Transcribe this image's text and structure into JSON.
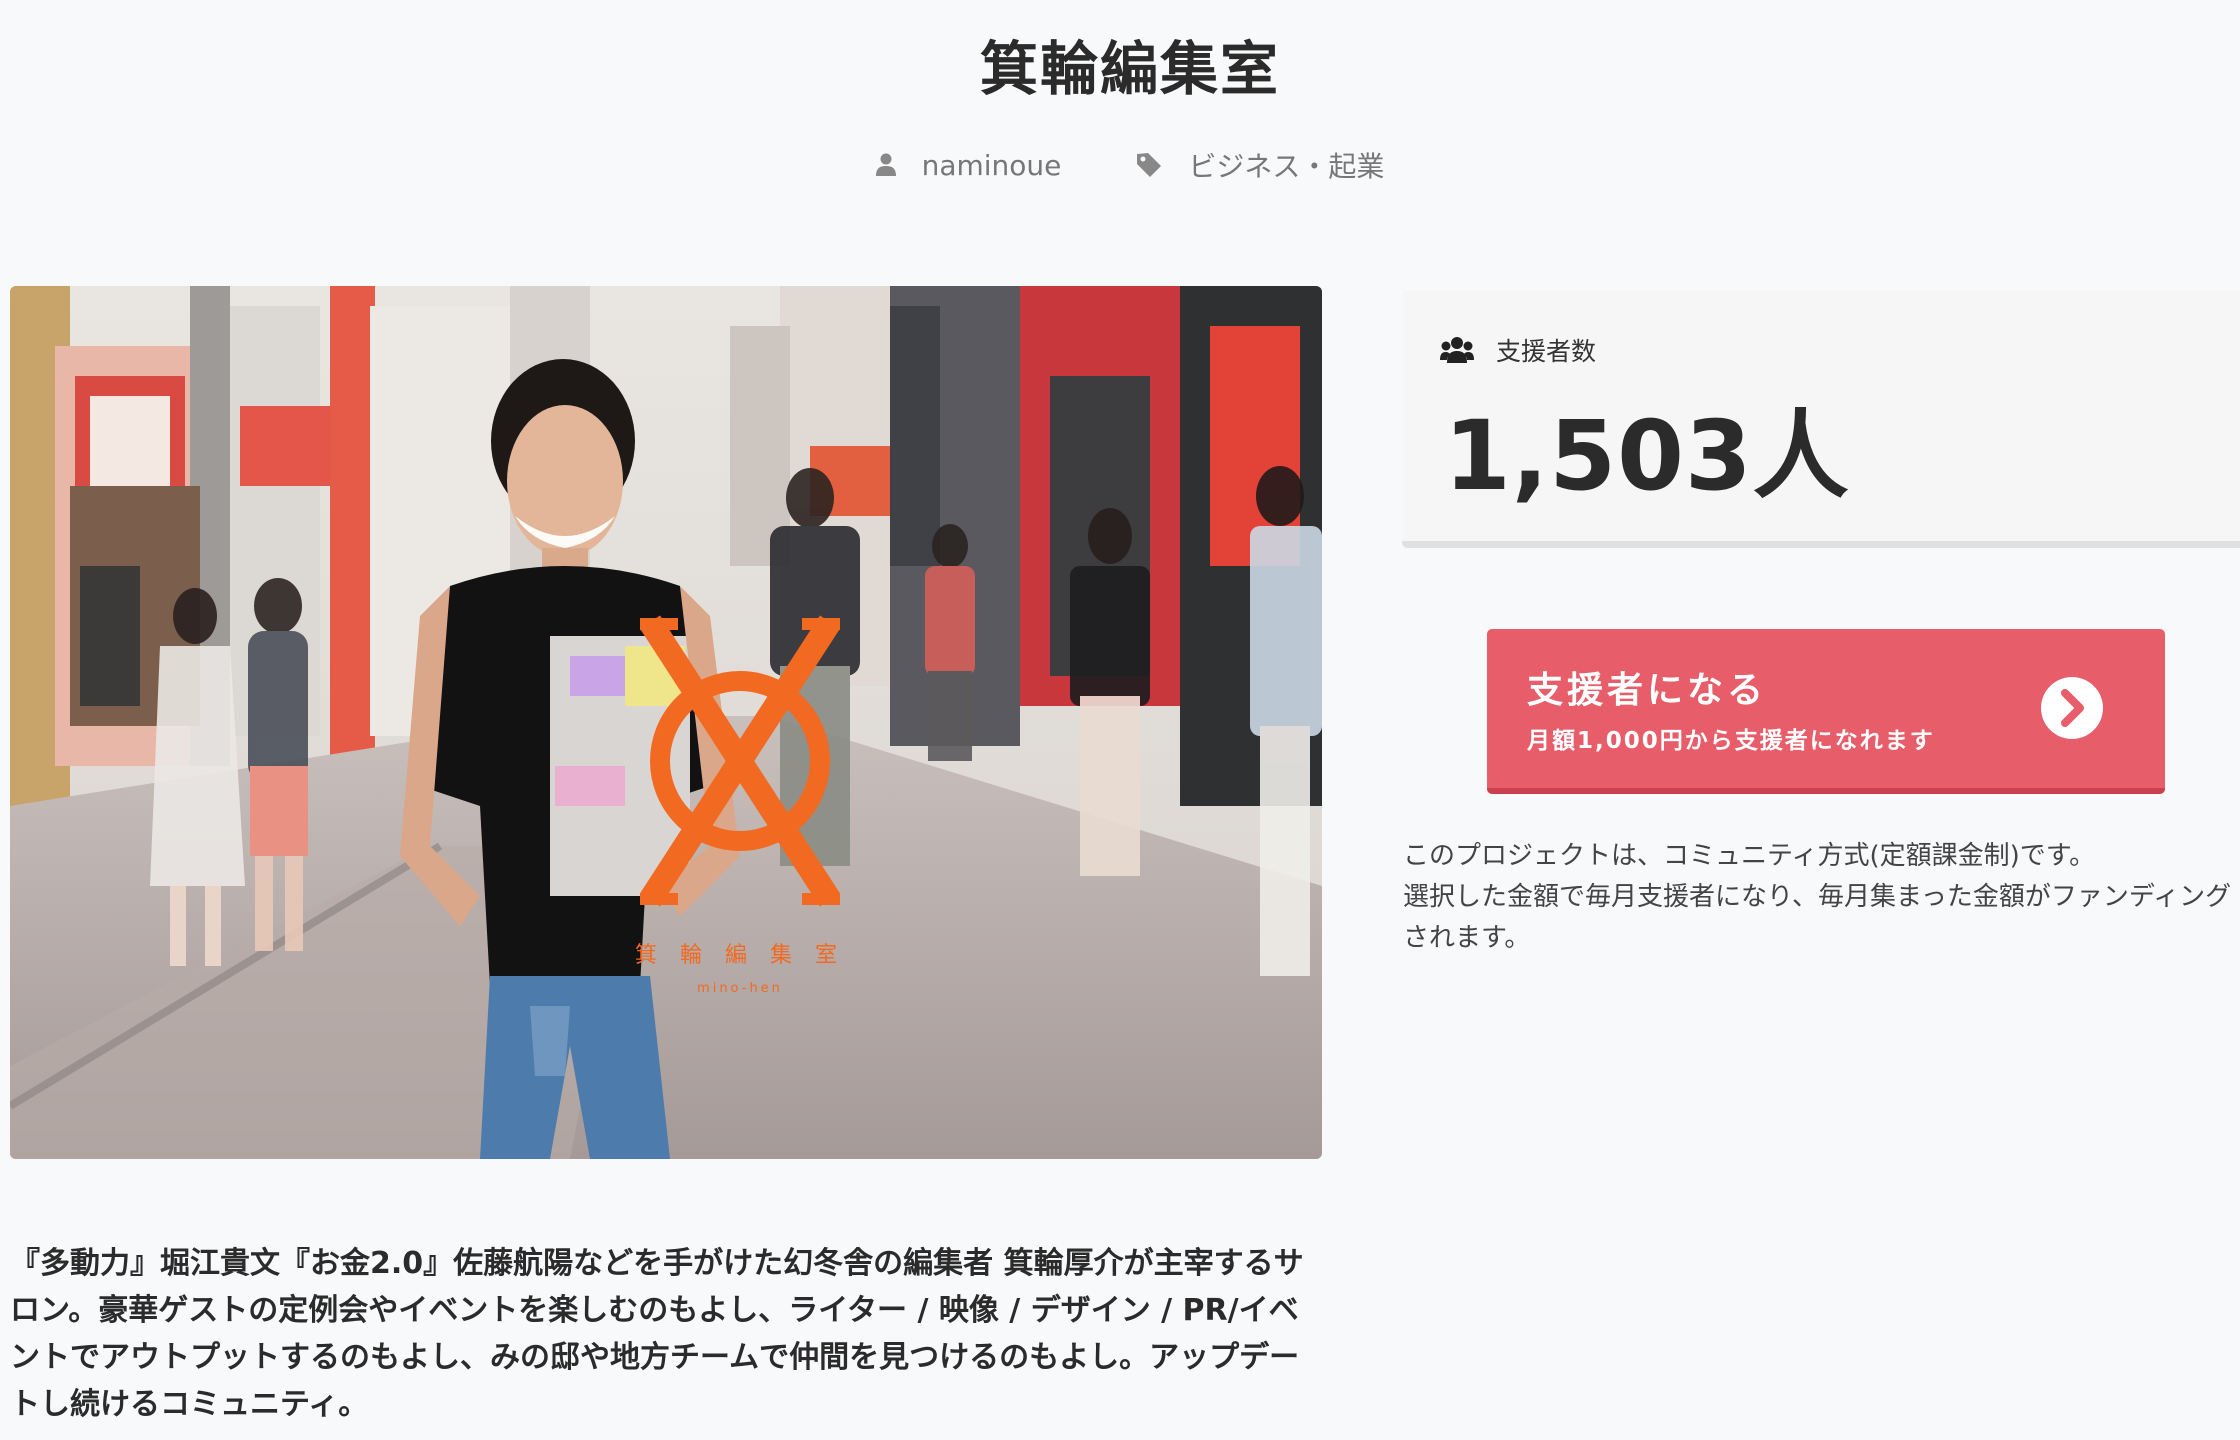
{
  "header": {
    "title": "箕輪編集室",
    "author": "naminoue",
    "category": "ビジネス・起業"
  },
  "hero": {
    "alt": "箕輪編集室 mino-hen",
    "logo_text": "箕 輪 編 集 室",
    "logo_subtext": "mino-hen",
    "logo_color": "#f26a21"
  },
  "description": "『多動力』堀江貴文『お金2.0』佐藤航陽などを手がけた幻冬舎の編集者 箕輪厚介が主宰するサロン。豪華ゲストの定例会やイベントを楽しむのもよし、ライター / 映像 / デザイン / PR/イベントでアウトプットするのもよし、みの邸や地方チームで仲間を見つけるのもよし。アップデートし続けるコミュニティ。",
  "supporters": {
    "label": "支援者数",
    "count": "1,503人"
  },
  "join": {
    "title": "支援者になる",
    "subtitle": "月額1,000円から支援者になれます",
    "accent": "#e75d6a"
  },
  "explain": {
    "line1": "このプロジェクトは、コミュニティ方式(定額課金制)です。",
    "line2": "選択した金額で毎月支援者になり、毎月集まった金額がファンディングされます。"
  },
  "icons": {
    "author": "user-icon",
    "category": "tag-icon",
    "supporters": "users-icon",
    "join": "chevron-right-circle-icon"
  }
}
